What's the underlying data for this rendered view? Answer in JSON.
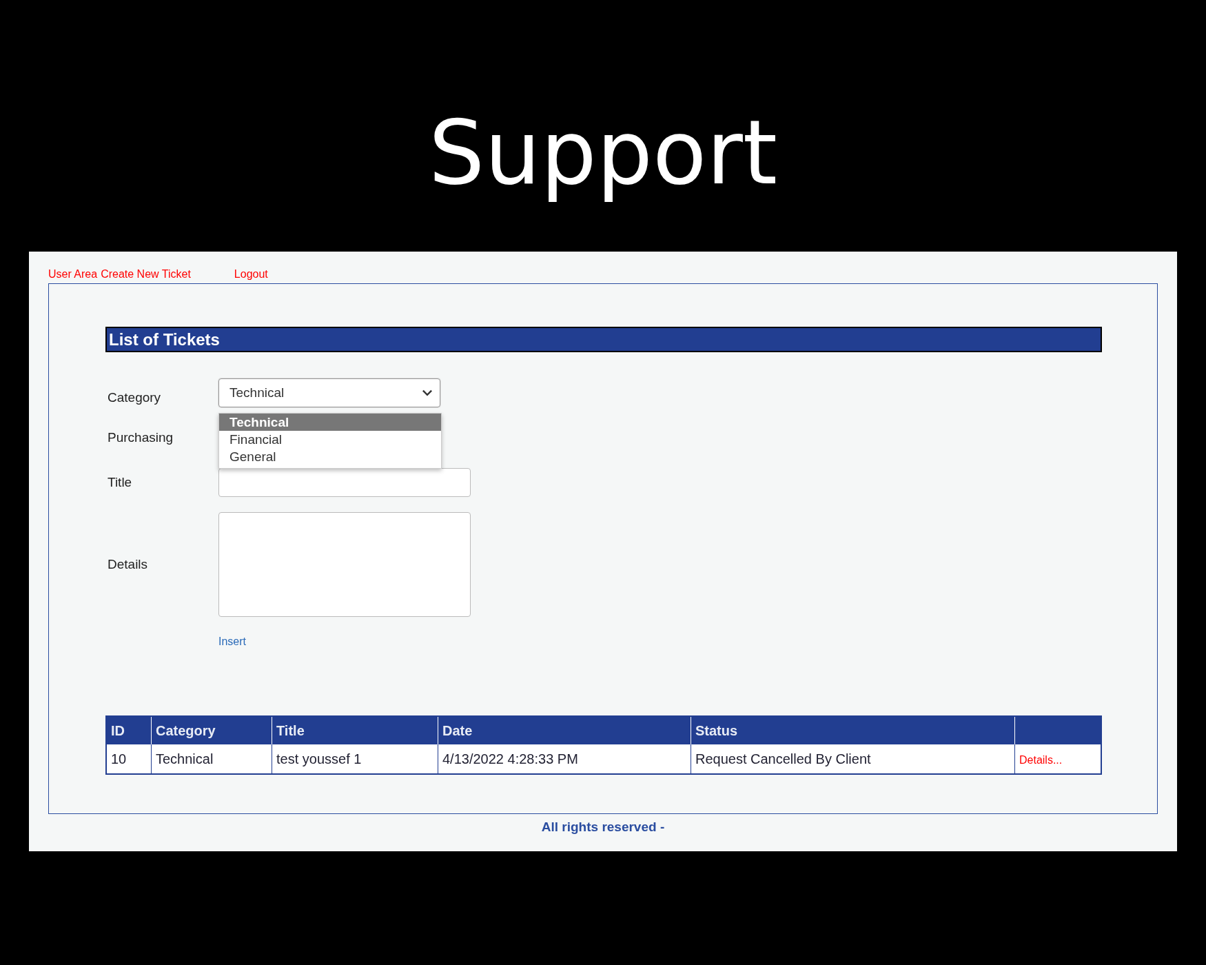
{
  "slide_title": "Support",
  "nav_links": [
    {
      "label": "User Area"
    },
    {
      "label": "Create New Ticket"
    },
    {
      "label": "Logout"
    }
  ],
  "header": "List of Tickets",
  "form": {
    "fields": [
      {
        "kind": "select",
        "label": "Category",
        "value": "Technical",
        "expanded": true,
        "options": [
          {
            "label": "Technical",
            "selected": true
          },
          {
            "label": "Financial",
            "selected": false
          },
          {
            "label": "General",
            "selected": false
          }
        ]
      },
      {
        "kind": "covered",
        "label": "Purchasing"
      },
      {
        "kind": "text",
        "label": "Title"
      },
      {
        "kind": "textarea",
        "label": "Details"
      }
    ],
    "submit": "Insert"
  },
  "table": {
    "columns": [
      "ID",
      "Category",
      "Title",
      "Date",
      "Status"
    ],
    "rows": [
      {
        "cells": [
          "10",
          "Technical",
          "test youssef 1",
          "4/13/2022 4:28:33 PM",
          "Request Cancelled By Client"
        ],
        "link": "Details..."
      }
    ]
  },
  "footer": "All rights reserved -"
}
